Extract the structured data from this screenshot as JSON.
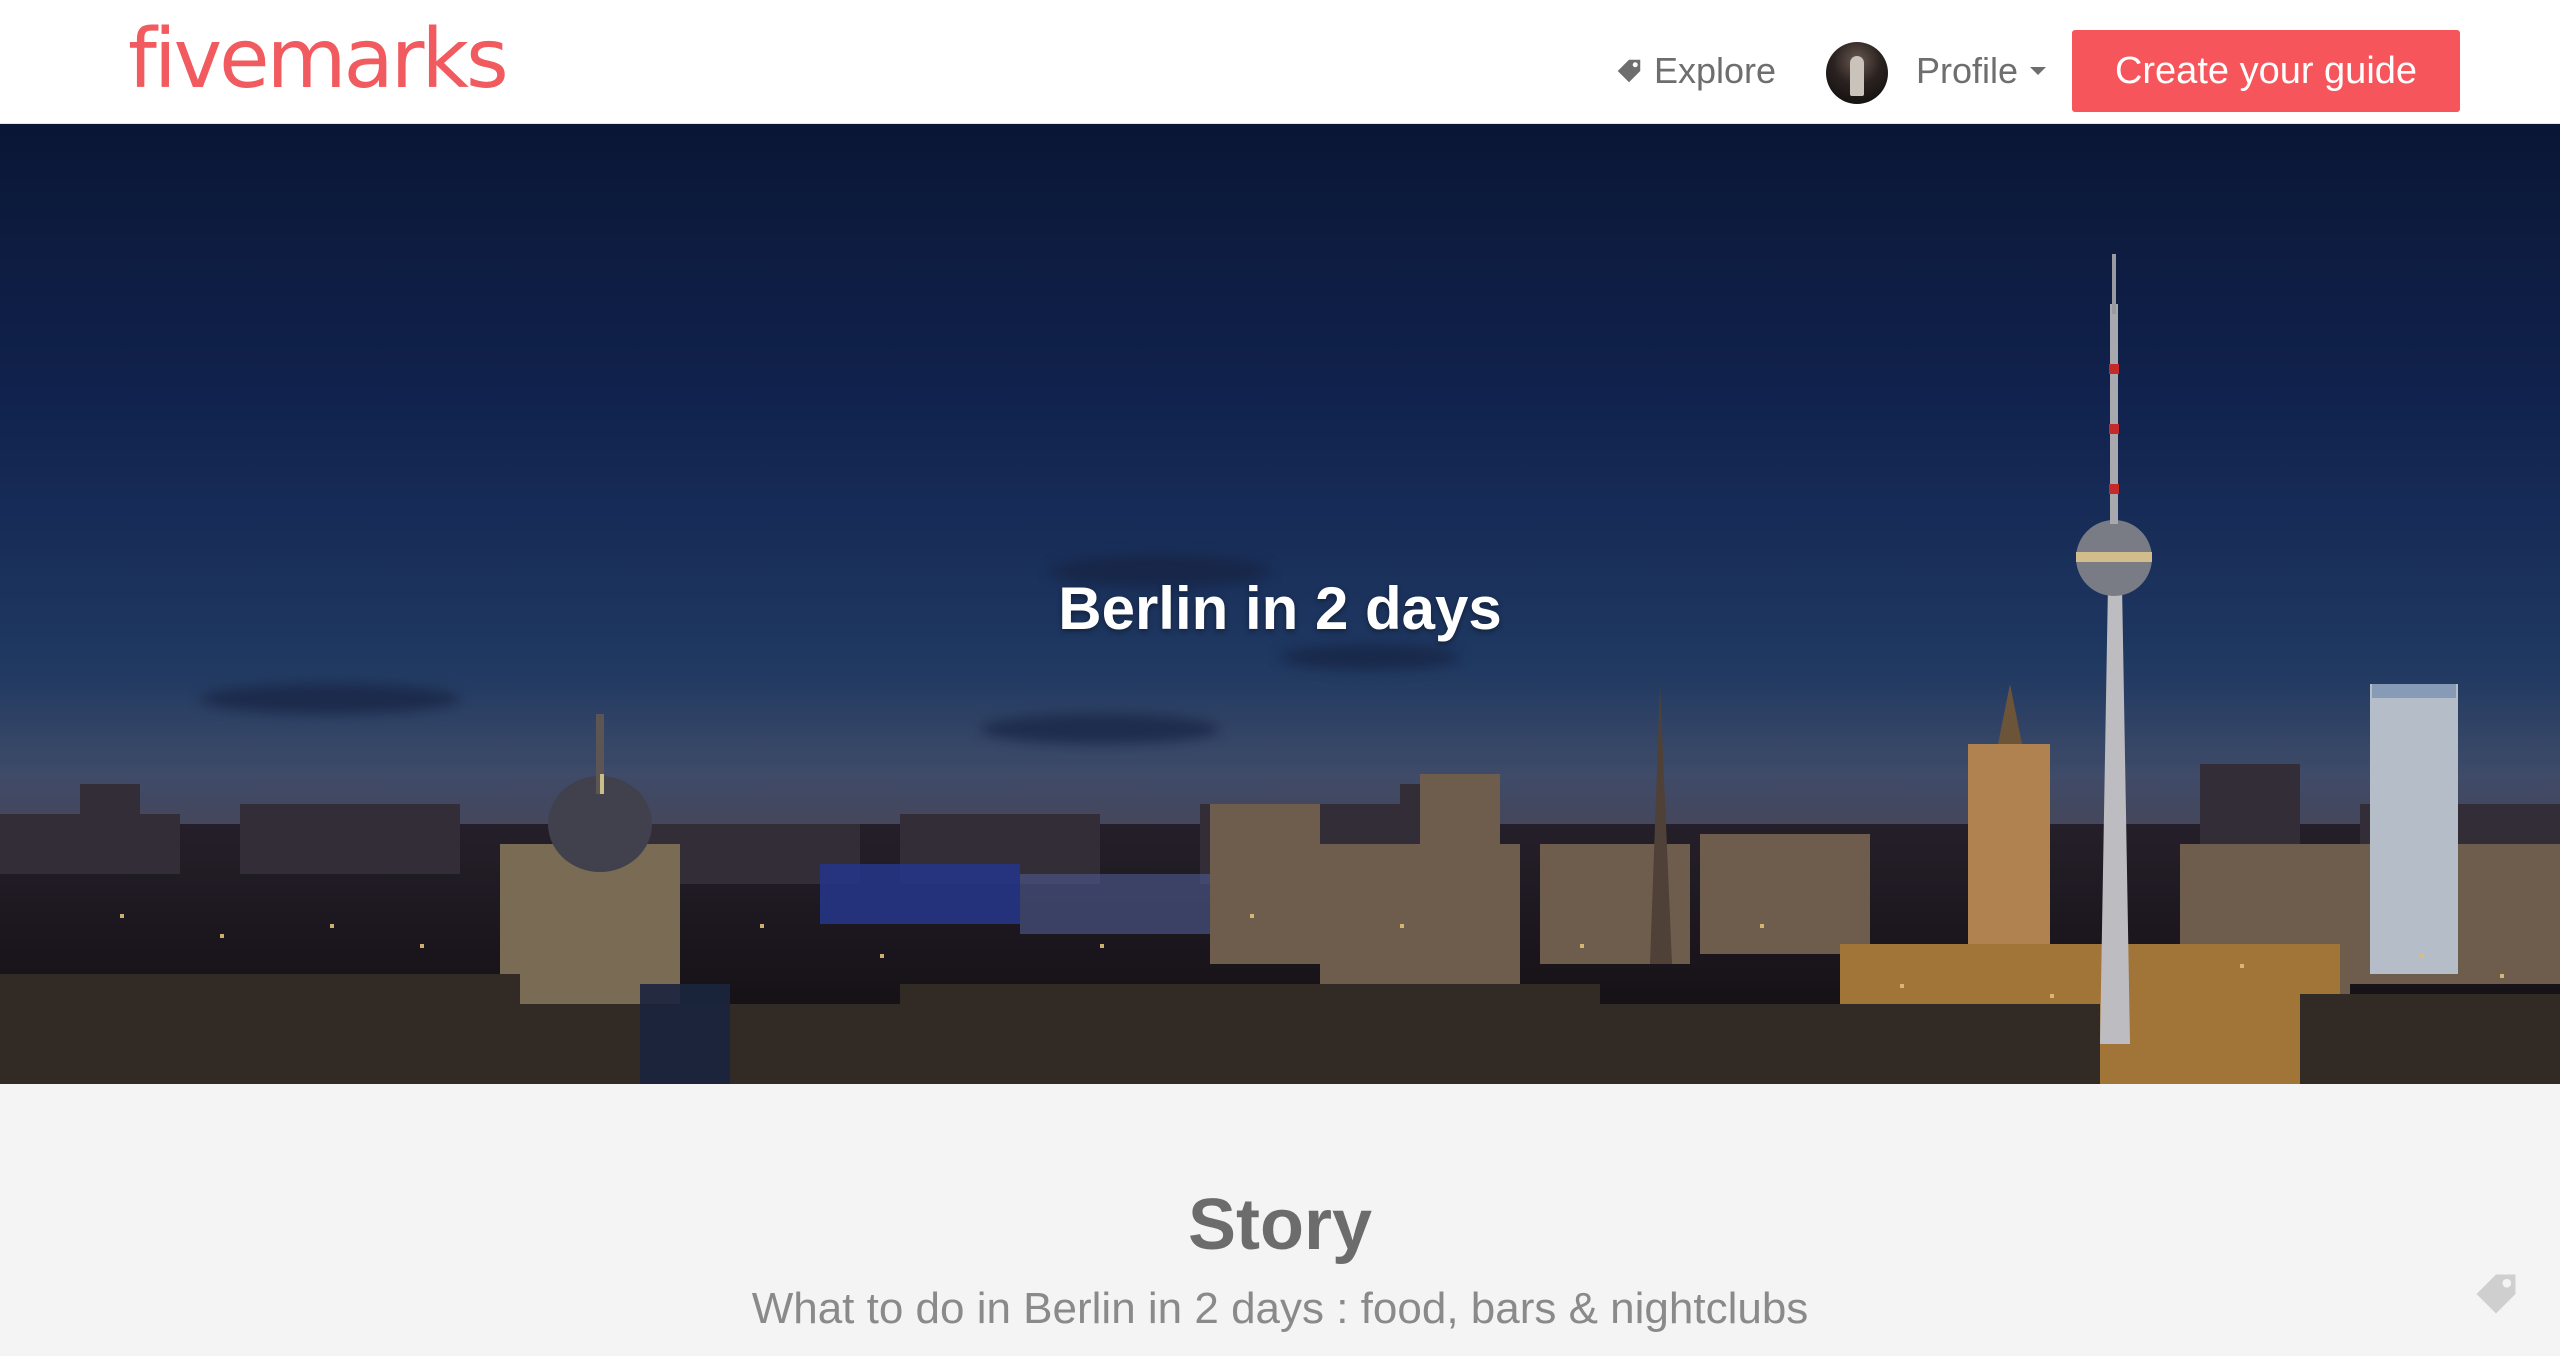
{
  "app": {
    "logo_text": "fivemarks",
    "brand_color": "#f15a5f"
  },
  "nav": {
    "explore_label": "Explore",
    "explore_icon": "tag-icon",
    "profile_label": "Profile",
    "cta_label": "Create your guide",
    "cta_color": "#f6555b"
  },
  "hero": {
    "title": "Berlin in 2 days"
  },
  "story": {
    "heading": "Story",
    "subtitle": "What to do in Berlin in 2 days : food, bars & nightclubs"
  }
}
